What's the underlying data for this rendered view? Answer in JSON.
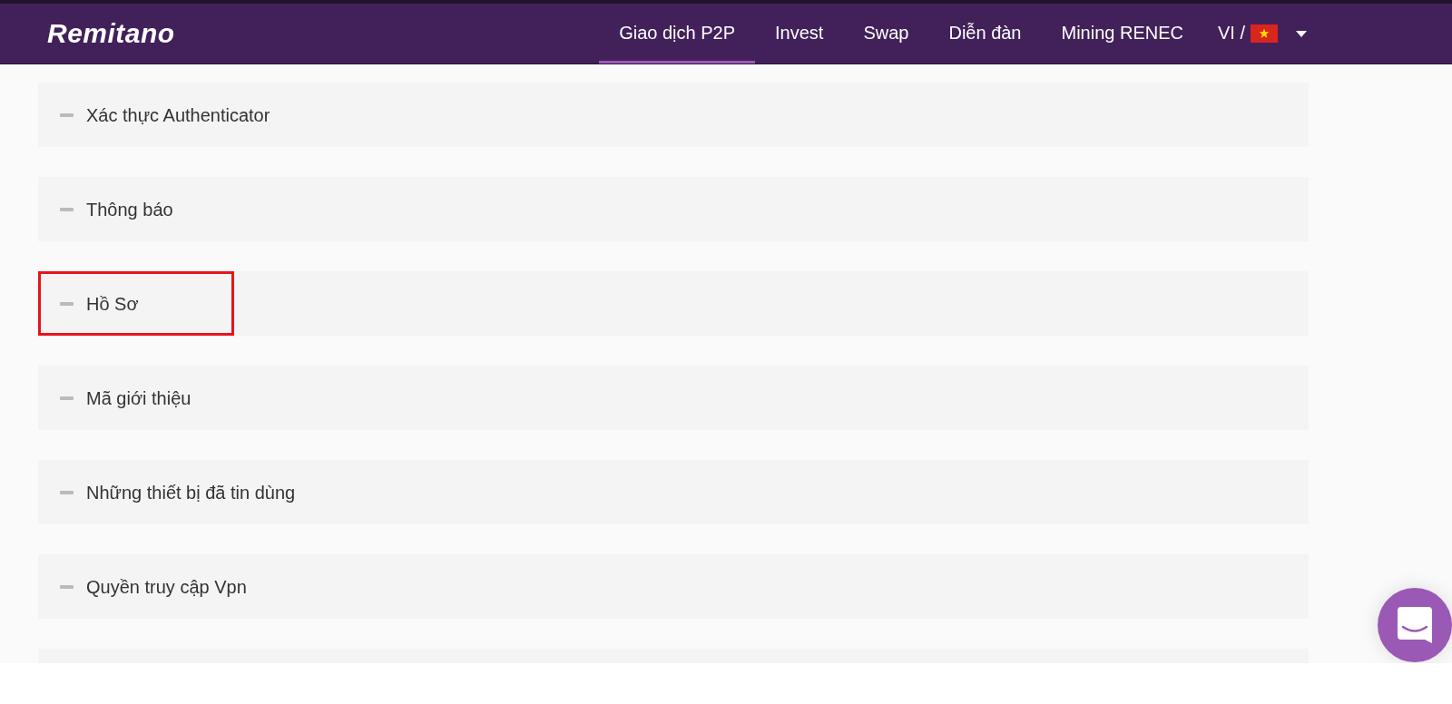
{
  "navbar": {
    "logo": "Remitano",
    "links": [
      {
        "label": "Giao dịch P2P",
        "selected": true
      },
      {
        "label": "Invest",
        "selected": false
      },
      {
        "label": "Swap",
        "selected": false
      },
      {
        "label": "Diễn đàn",
        "selected": false
      },
      {
        "label": "Mining RENEC",
        "selected": false
      }
    ],
    "language": {
      "label": "VI /"
    }
  },
  "sections": [
    {
      "label": "Xác thực Authenticator",
      "expanded": true,
      "highlighted": false
    },
    {
      "label": "Thông báo",
      "expanded": true,
      "highlighted": false
    },
    {
      "label": "Hồ Sơ",
      "expanded": true,
      "highlighted": true
    },
    {
      "label": "Mã giới thiệu",
      "expanded": true,
      "highlighted": false
    },
    {
      "label": "Những thiết bị đã tin dùng",
      "expanded": true,
      "highlighted": false
    },
    {
      "label": "Quyền truy cập Vpn",
      "expanded": true,
      "highlighted": false
    }
  ]
}
